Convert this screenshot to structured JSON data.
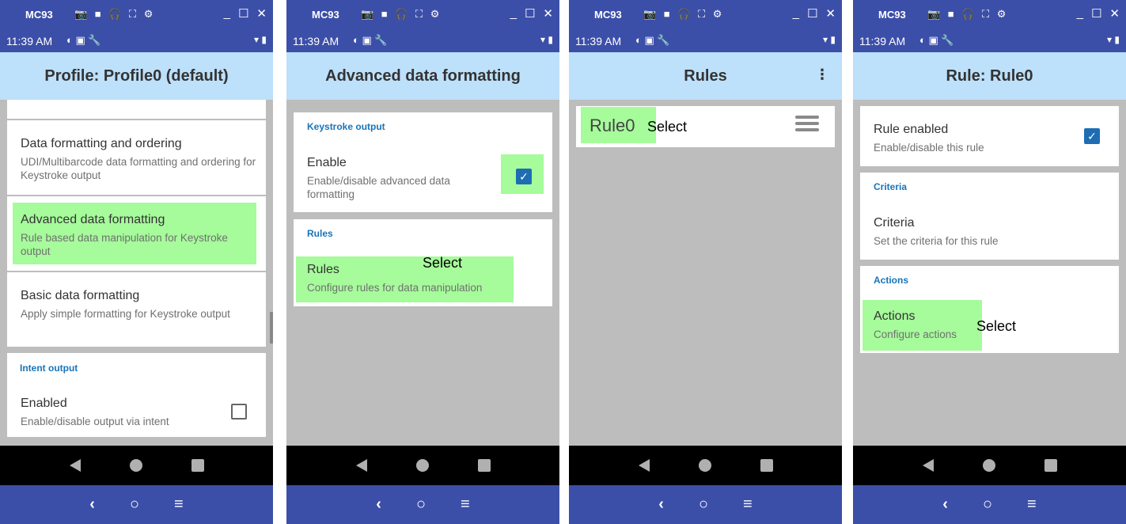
{
  "device": {
    "name": "MC93",
    "time": "11:39 AM",
    "titlebar_icons": "📷 ■ 🎧 ⛶ ⚙",
    "window_controls": {
      "minimize": "_",
      "maximize": "☐",
      "close": "✕"
    },
    "status_icons": "◐ ▣ 🔧",
    "status_right": "▾ ▮",
    "nav": {
      "back": "back-icon",
      "home": "home-icon",
      "recent": "recent-icon"
    },
    "host_nav": {
      "back": "‹",
      "home": "○",
      "menu": "≡"
    }
  },
  "select_label": "Select",
  "screens": [
    {
      "title": "Profile: Profile0 (default)",
      "items": [
        {
          "title": "Data formatting and ordering",
          "subtitle": "UDI/Multibarcode data formatting and ordering for Keystroke output"
        },
        {
          "title": "Advanced data formatting",
          "subtitle": "Rule based data manipulation for Keystroke output"
        },
        {
          "title": "Basic data formatting",
          "subtitle": "Apply simple formatting for Keystroke output"
        }
      ],
      "section": "Intent output",
      "enabled_item": {
        "title": "Enabled",
        "subtitle": "Enable/disable output via intent",
        "checked": false
      }
    },
    {
      "title": "Advanced data formatting",
      "section1": "Keystroke output",
      "enable_item": {
        "title": "Enable",
        "subtitle": "Enable/disable advanced data formatting",
        "checked": true
      },
      "section2": "Rules",
      "rules_item": {
        "title": "Rules",
        "subtitle": "Configure rules for data manipulation"
      }
    },
    {
      "title": "Rules",
      "overflow_icon": "⋮",
      "rule_name": "Rule0"
    },
    {
      "title": "Rule: Rule0",
      "rule_enabled": {
        "title": "Rule enabled",
        "subtitle": "Enable/disable this rule",
        "checked": true
      },
      "criteria_section": "Criteria",
      "criteria_item": {
        "title": "Criteria",
        "subtitle": "Set the criteria for this rule"
      },
      "actions_section": "Actions",
      "actions_item": {
        "title": "Actions",
        "subtitle": "Configure actions"
      }
    }
  ],
  "colors": {
    "host_bar": "#3c4fa8",
    "app_bar": "#bde0fb",
    "highlight": "#a6fb9b",
    "section_header": "#1a74b8",
    "checkbox_checked": "#1e6db3",
    "background": "#bdbdbd"
  }
}
